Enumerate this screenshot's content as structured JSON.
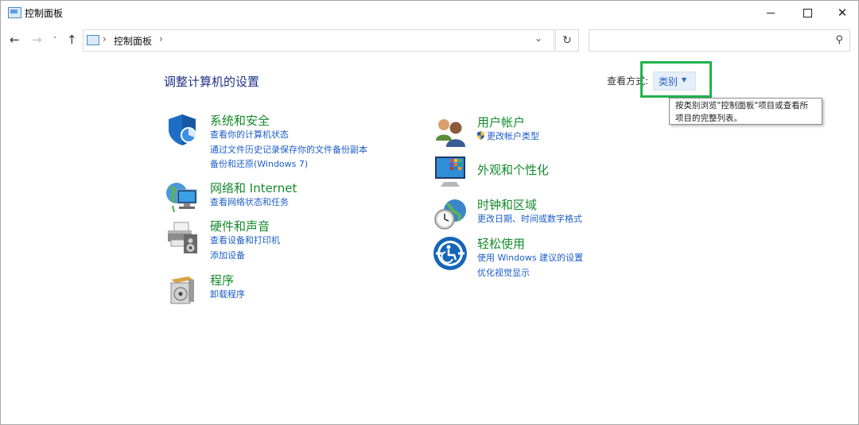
{
  "window": {
    "title": "控制面板"
  },
  "address": {
    "path": "控制面板"
  },
  "search": {
    "placeholder": ""
  },
  "main": {
    "heading": "调整计算机的设置",
    "view_by_label": "查看方式:",
    "view_by_value": "类别",
    "tooltip_line1": "按类别浏览\"控制面板\"项目或查看所",
    "tooltip_line2": "项目的完整列表。"
  },
  "categories": {
    "system": {
      "title": "系统和安全",
      "links": [
        "查看你的计算机状态",
        "通过文件历史记录保存你的文件备份副本",
        "备份和还原(Windows 7)"
      ]
    },
    "network": {
      "title": "网络和 Internet",
      "links": [
        "查看网络状态和任务"
      ]
    },
    "hardware": {
      "title": "硬件和声音",
      "links": [
        "查看设备和打印机",
        "添加设备"
      ]
    },
    "programs": {
      "title": "程序",
      "links": [
        "卸载程序"
      ]
    },
    "users": {
      "title": "用户帐户",
      "links": [
        "更改帐户类型"
      ]
    },
    "appearance": {
      "title": "外观和个性化",
      "links": []
    },
    "clock": {
      "title": "时钟和区域",
      "links": [
        "更改日期、时间或数字格式"
      ]
    },
    "ease": {
      "title": "轻松使用",
      "links": [
        "使用 Windows 建议的设置",
        "优化视觉显示"
      ]
    }
  },
  "icons": {
    "app": "control-panel-icon",
    "back": "arrow-left-icon",
    "forward": "arrow-right-icon",
    "up": "arrow-up-icon",
    "refresh": "refresh-icon",
    "search": "search-icon",
    "system": "shield-icon",
    "network": "network-globe-icon",
    "hardware": "printer-icon",
    "programs": "program-box-icon",
    "users": "users-icon",
    "appearance": "monitor-color-icon",
    "clock": "clock-globe-icon",
    "ease": "ease-of-access-icon"
  },
  "colors": {
    "accent": "#1c5dc8",
    "category_title": "#138a2b",
    "heading": "#1e3287",
    "highlight": "#22b24c"
  }
}
